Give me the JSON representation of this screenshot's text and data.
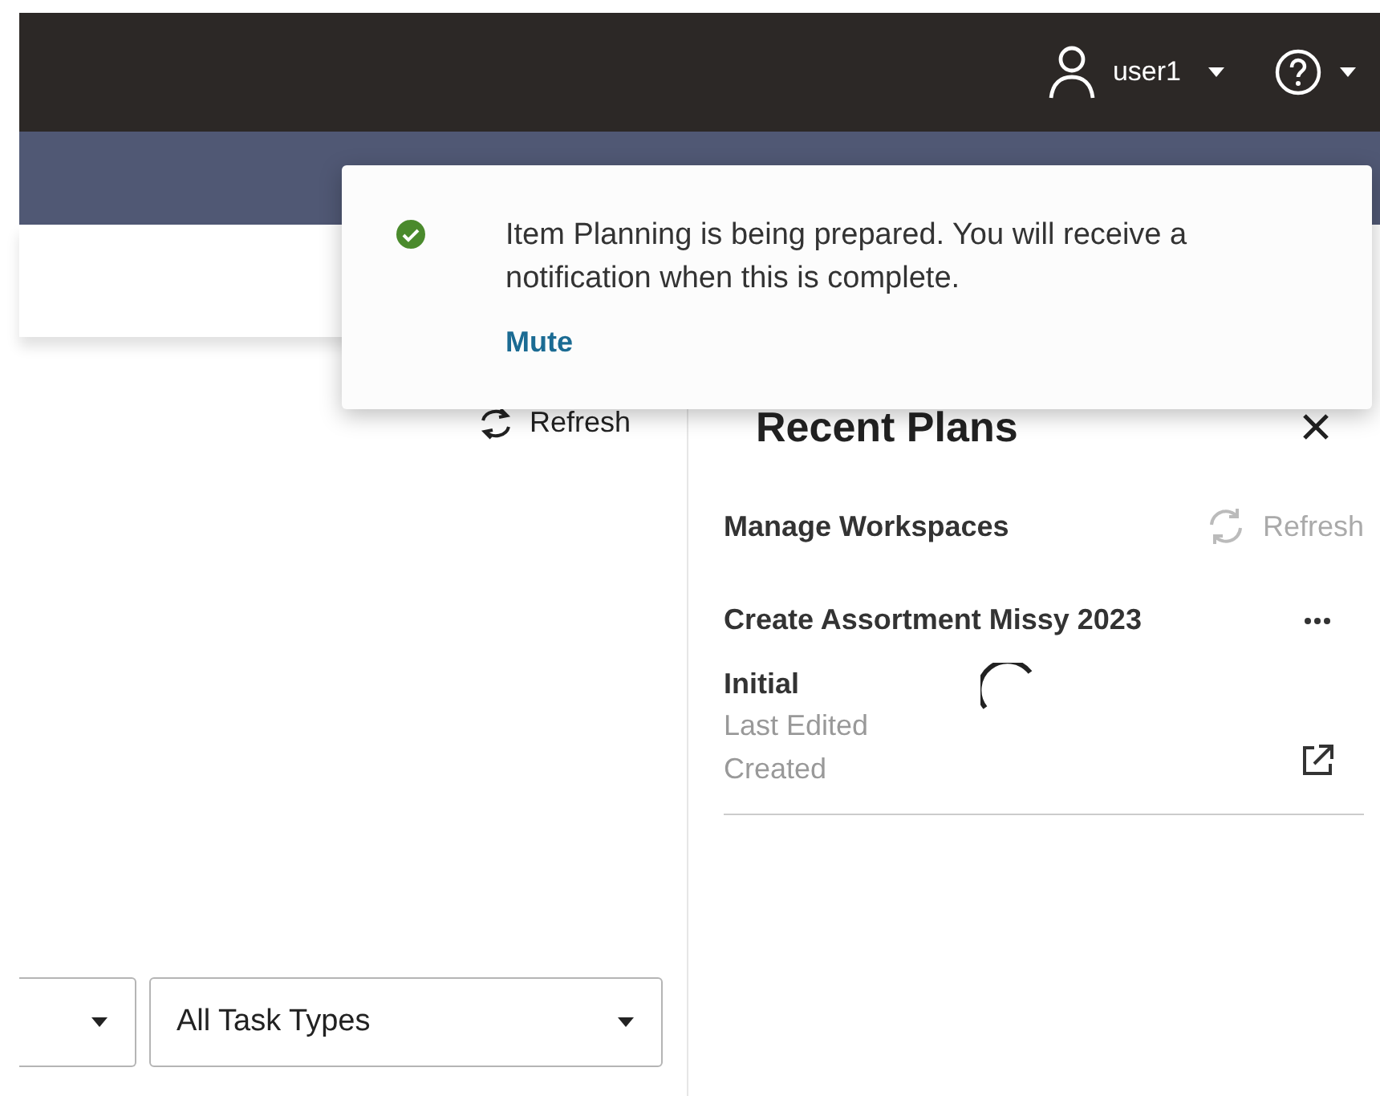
{
  "header": {
    "user": "user1"
  },
  "toast": {
    "message": "Item Planning is being prepared. You will receive a notification when this is complete.",
    "link": "Mute"
  },
  "toolbar": {
    "refresh": "Refresh"
  },
  "filters": [
    {
      "kind": "select"
    },
    {
      "kind": "select",
      "value": "All Task Types"
    }
  ],
  "recent_plans": {
    "title": "Recent Plans",
    "manage": "Manage Workspaces",
    "refresh": {
      "label": "Refresh",
      "disabled": true
    },
    "plans": [
      {
        "name": "Create Assortment Missy 2023",
        "status": "Initial",
        "loading": true,
        "fields": [
          "Last Edited",
          "Created"
        ]
      }
    ]
  }
}
